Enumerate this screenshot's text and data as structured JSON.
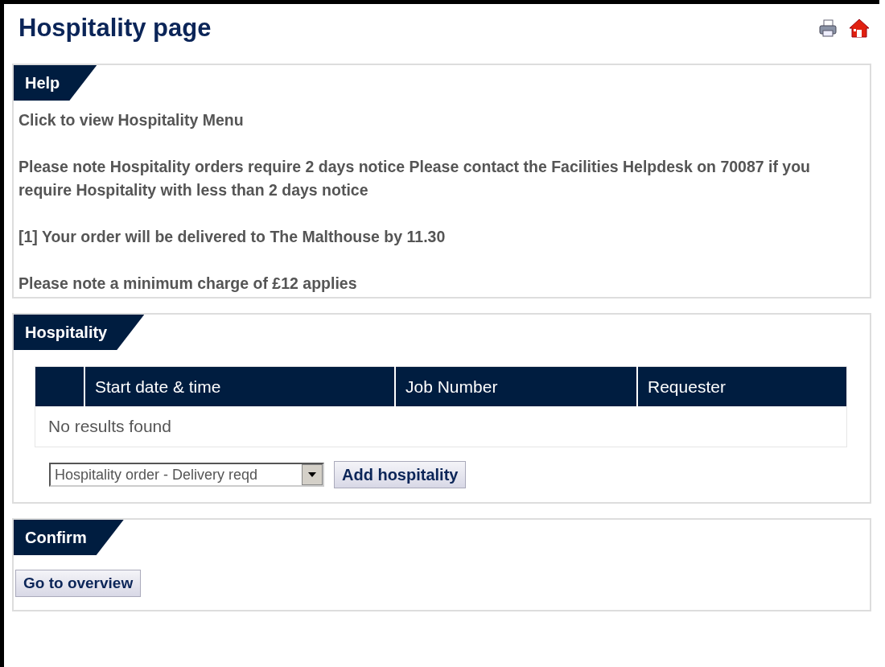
{
  "page": {
    "title": "Hospitality page"
  },
  "help": {
    "heading": "Help",
    "paragraphs": [
      "Click to view Hospitality Menu",
      "Please note Hospitality orders require 2 days notice Please contact the Facilities Helpdesk on 70087 if you require Hospitality with less than 2 days notice",
      "[1] Your order will be delivered to The Malthouse by 11.30",
      "Please note a minimum charge of £12 applies"
    ]
  },
  "hospitality": {
    "heading": "Hospitality",
    "table": {
      "columns": [
        "Start date & time",
        "Job Number",
        "Requester"
      ],
      "empty_message": "No results found"
    },
    "order_type": {
      "value": "Hospitality order - Delivery reqd"
    },
    "add_button": "Add hospitality"
  },
  "confirm": {
    "heading": "Confirm",
    "button": "Go to overview"
  }
}
